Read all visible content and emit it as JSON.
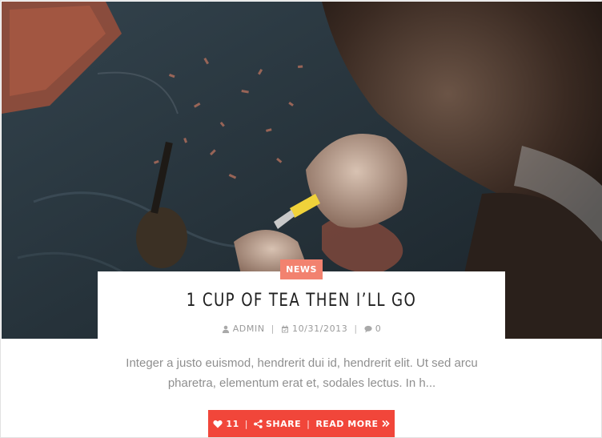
{
  "post": {
    "category": "NEWS",
    "title": "1 CUP OF TEA THEN I’LL GO",
    "author": "ADMIN",
    "date": "10/31/2013",
    "comments": "0",
    "excerpt": "Integer a justo euismod, hendrerit dui id, hendrerit elit. Ut sed arcu pharetra, elementum erat et, sodales lectus. In h..."
  },
  "actions": {
    "likes": "11",
    "share_label": "SHARE",
    "read_more_label": "READ MORE"
  },
  "colors": {
    "accent": "#f1463a",
    "badge": "#f2826f"
  },
  "icons": {
    "author": "user-icon",
    "date": "calendar-icon",
    "comments": "comment-icon",
    "like": "heart-icon",
    "share": "share-icon",
    "read_more": "double-chevron-right-icon"
  }
}
